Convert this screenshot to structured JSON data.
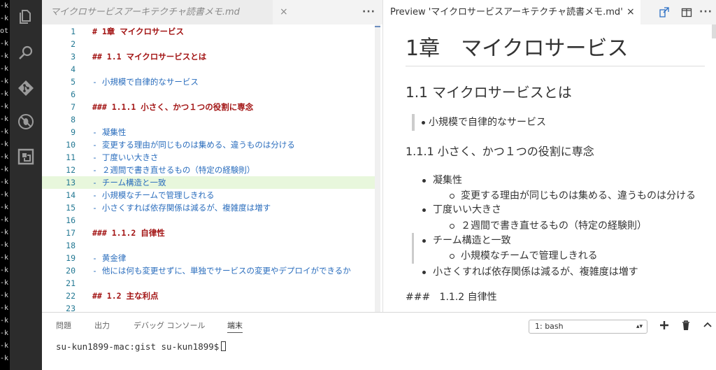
{
  "side_strip": [
    "-k",
    "-k",
    "ot",
    "-k",
    "-k",
    "-k",
    "-k",
    "-k",
    "-k",
    "-k",
    "-k",
    "-k",
    "-k",
    "-k",
    "-k",
    "-k",
    "-k",
    "-k",
    "-k",
    "-k",
    "-k",
    "-k",
    "-k",
    "-k",
    "-k",
    "-k",
    "-k",
    "-k",
    "-k"
  ],
  "activity_bar": [
    "files-icon",
    "search-icon",
    "source-control-icon",
    "debug-icon",
    "extensions-icon"
  ],
  "editor": {
    "tab_title": "マイクロサービスアーキテクチャ読書メモ.md",
    "tab_close": "×",
    "more": "···",
    "lines": [
      {
        "n": "1",
        "text": "# 1章  マイクロサービス",
        "kind": "h"
      },
      {
        "n": "2",
        "text": "",
        "kind": "b"
      },
      {
        "n": "3",
        "text": "## 1.1 マイクロサービスとは",
        "kind": "h"
      },
      {
        "n": "4",
        "text": "",
        "kind": "b"
      },
      {
        "n": "5",
        "text": "- 小規模で自律的なサービス",
        "kind": "b"
      },
      {
        "n": "6",
        "text": "",
        "kind": "b"
      },
      {
        "n": "7",
        "text": "### 1.1.1 小さく、かつ１つの役割に専念",
        "kind": "h"
      },
      {
        "n": "8",
        "text": "",
        "kind": "b"
      },
      {
        "n": "9",
        "text": "- 凝集性",
        "kind": "b"
      },
      {
        "n": "10",
        "text": "  - 変更する理由が同じものは集める、違うものは分ける",
        "kind": "b"
      },
      {
        "n": "11",
        "text": "- 丁度いい大きさ",
        "kind": "b"
      },
      {
        "n": "12",
        "text": "  - ２週間で書き直せるもの（特定の経験則）",
        "kind": "b"
      },
      {
        "n": "13",
        "text": "- チーム構造と一致",
        "kind": "b",
        "highlight": true
      },
      {
        "n": "14",
        "text": "  - 小規模なチームで管理しきれる",
        "kind": "b"
      },
      {
        "n": "15",
        "text": "- 小さくすれば依存関係は減るが、複雑度は増す",
        "kind": "b"
      },
      {
        "n": "16",
        "text": "",
        "kind": "b"
      },
      {
        "n": "17",
        "text": "###  1.1.2 自律性",
        "kind": "h"
      },
      {
        "n": "18",
        "text": "",
        "kind": "b"
      },
      {
        "n": "19",
        "text": "- 黄金律",
        "kind": "b"
      },
      {
        "n": "20",
        "text": "  - 他には何も変更せずに、単独でサービスの変更やデプロイができるか",
        "kind": "b"
      },
      {
        "n": "21",
        "text": "",
        "kind": "b"
      },
      {
        "n": "22",
        "text": "## 1.2 主な利点",
        "kind": "h"
      },
      {
        "n": "23",
        "text": "",
        "kind": "b"
      }
    ]
  },
  "preview": {
    "tab_title": "Preview 'マイクロサービスアーキテクチャ読書メモ.md'",
    "tab_close": "×",
    "more": "···",
    "h1": "1章　マイクロサービス",
    "h2": "1.1 マイクロサービスとは",
    "blockquote": "小規模で自律的なサービス",
    "h3": "1.1.1 小さく、かつ１つの役割に専念",
    "list": [
      {
        "level": 1,
        "text": "凝集性"
      },
      {
        "level": 2,
        "text": "変更する理由が同じものは集める、違うものは分ける"
      },
      {
        "level": 1,
        "text": "丁度いい大きさ"
      },
      {
        "level": 2,
        "text": "２週間で書き直せるもの（特定の経験則）"
      },
      {
        "level": 1,
        "text": "チーム構造と一致"
      },
      {
        "level": 2,
        "text": "小規模なチームで管理しきれる"
      },
      {
        "level": 1,
        "text": "小さくすれば依存関係は減るが、複雑度は増す"
      }
    ],
    "raw_text": "###   1.1.2 自律性"
  },
  "panel": {
    "tabs": [
      "問題",
      "出力",
      "デバッグ コンソール",
      "端末"
    ],
    "active_tab": "端末",
    "terminal_select": "1: bash",
    "prompt": "su-kun1899-mac:gist su-kun1899$"
  },
  "colors": {
    "heading": "#a31515",
    "list": "#2a6dbd",
    "line_number": "#237893",
    "activity_bar": "#2c2c2c"
  }
}
